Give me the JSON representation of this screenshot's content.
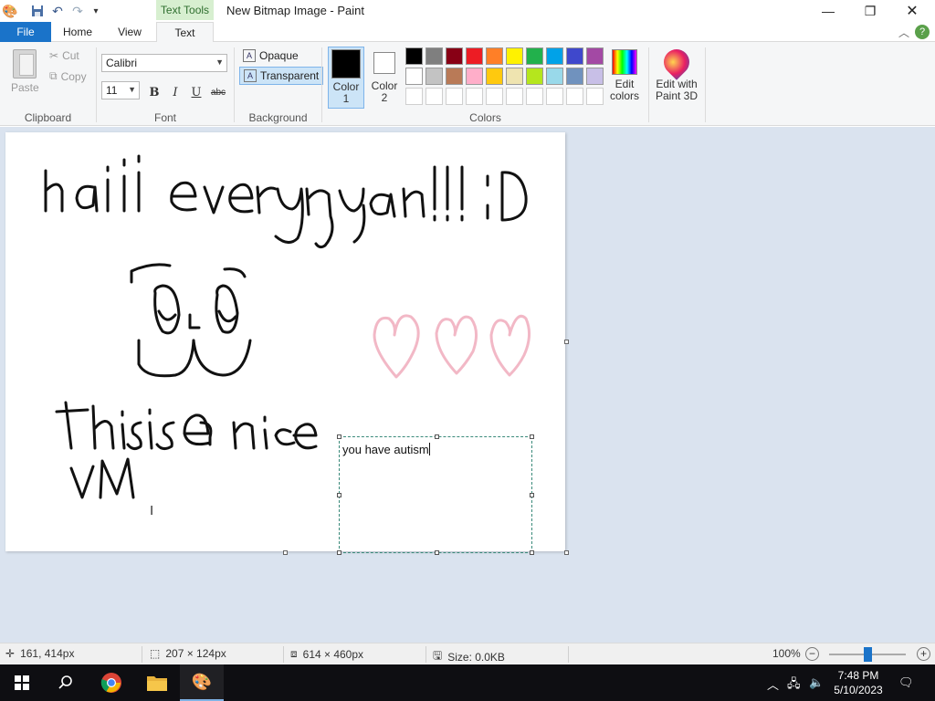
{
  "window": {
    "title": "New Bitmap Image - Paint",
    "contextual_tab": "Text Tools",
    "controls": {
      "minimize": "—",
      "restore": "❐",
      "close": "✕"
    }
  },
  "quick_access": {
    "icons": [
      "paint-app-icon",
      "save-icon",
      "undo-icon",
      "redo-icon",
      "customize-icon"
    ]
  },
  "ribbon_tabs": {
    "file": "File",
    "home": "Home",
    "view": "View",
    "text": "Text"
  },
  "clipboard": {
    "paste": "Paste",
    "cut": "Cut",
    "copy": "Copy",
    "label": "Clipboard"
  },
  "font": {
    "family": "Calibri",
    "size": "11",
    "bold": "B",
    "italic": "I",
    "underline": "U",
    "strikethrough": "abc",
    "label": "Font"
  },
  "background": {
    "opaque": "Opaque",
    "transparent": "Transparent",
    "label": "Background",
    "selected": "transparent"
  },
  "colors": {
    "color1_label": "Color\n1",
    "color2_label": "Color\n2",
    "color1": "#000000",
    "color2": "#ffffff",
    "edit_colors": "Edit\ncolors",
    "label": "Colors",
    "palette": [
      "#000000",
      "#7f7f7f",
      "#880015",
      "#ed1c24",
      "#ff7f27",
      "#fff200",
      "#22b14c",
      "#00a2e8",
      "#3f48cc",
      "#a349a4",
      "#ffffff",
      "#c3c3c3",
      "#b97a57",
      "#ffaec9",
      "#ffc90e",
      "#efe4b0",
      "#b5e61d",
      "#99d9ea",
      "#7092be",
      "#c8bfe7",
      "#ffffff",
      "#ffffff",
      "#ffffff",
      "#ffffff",
      "#ffffff",
      "#ffffff",
      "#ffffff",
      "#ffffff",
      "#ffffff",
      "#ffffff"
    ]
  },
  "paint3d": {
    "label": "Edit with\nPaint 3D"
  },
  "canvas": {
    "textbox_text": "you have autism"
  },
  "statusbar": {
    "cursor_pos": "161, 414px",
    "selection_size": "207 × 124px",
    "image_size": "614 × 460px",
    "file_size": "Size: 0.0KB",
    "zoom": "100%"
  },
  "taskbar": {
    "time": "7:48 PM",
    "date": "5/10/2023"
  }
}
